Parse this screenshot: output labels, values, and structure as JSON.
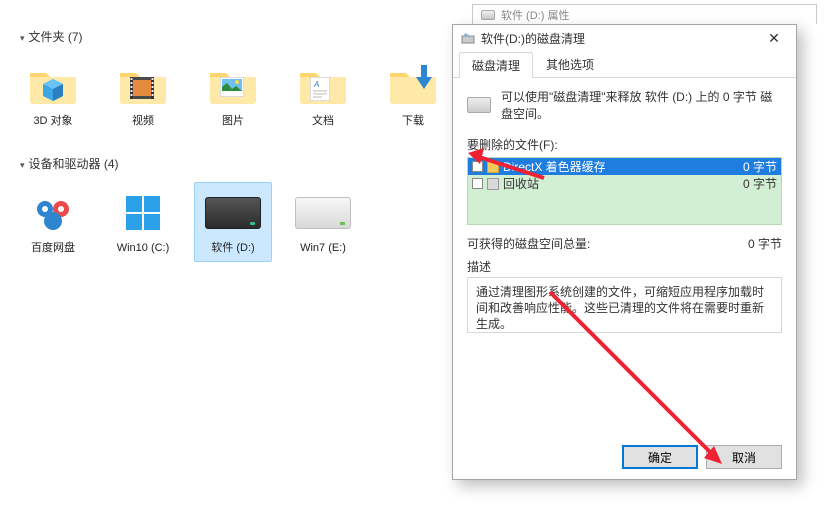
{
  "explorer": {
    "sections": {
      "folders": {
        "header": "文件夹 (7)"
      },
      "devices": {
        "header": "设备和驱动器 (4)"
      }
    },
    "folders": {
      "objects3d": "3D 对象",
      "videos": "视频",
      "pictures": "图片",
      "documents": "文档",
      "downloads": "下载"
    },
    "drives": {
      "baidu": "百度网盘",
      "win10c": "Win10 (C:)",
      "softwared": "软件 (D:)",
      "win7e": "Win7 (E:)"
    }
  },
  "behind_title": "软件 (D:) 属性",
  "dialog": {
    "title": "软件(D:)的磁盘清理",
    "tabs": {
      "cleanup": "磁盘清理",
      "other": "其他选项"
    },
    "description": "可以使用\"磁盘清理\"来释放 软件 (D:) 上的 0 字节 磁盘空间。",
    "files_label": "要删除的文件(F):",
    "files": [
      {
        "name": "DirectX 着色器缓存",
        "size": "0 字节",
        "selected": true
      },
      {
        "name": "回收站",
        "size": "0 字节",
        "selected": false
      }
    ],
    "total_label": "可获得的磁盘空间总量:",
    "total_value": "0 字节",
    "desc_label": "描述",
    "desc_text": "通过清理图形系统创建的文件，可缩短应用程序加载时间和改善响应性能。这些已清理的文件将在需要时重新生成。",
    "buttons": {
      "ok": "确定",
      "cancel": "取消"
    }
  }
}
